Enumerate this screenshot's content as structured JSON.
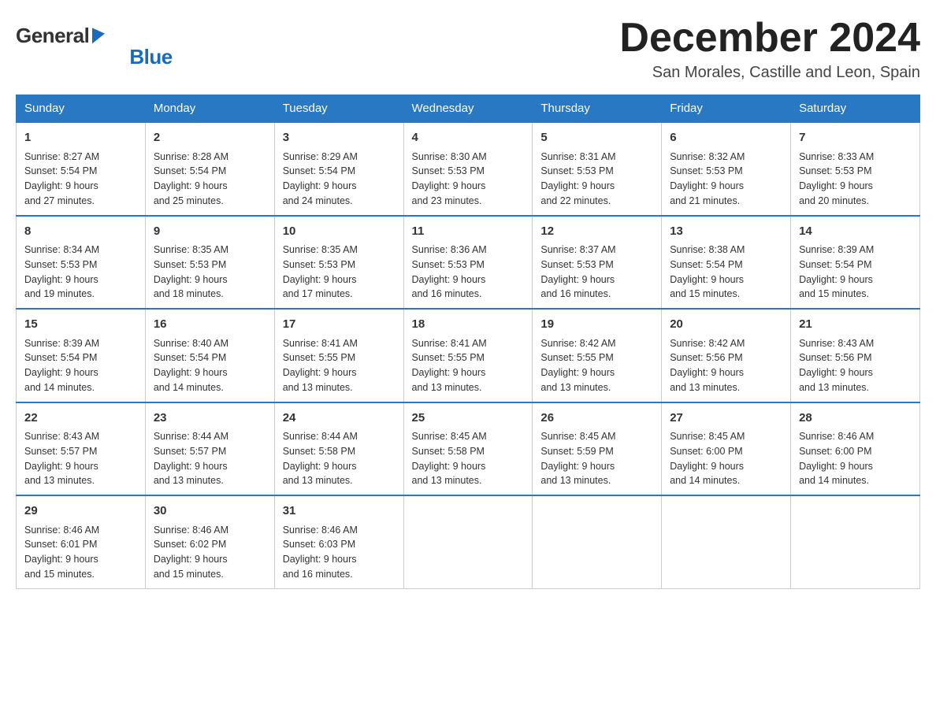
{
  "header": {
    "logo_general": "General",
    "logo_blue": "Blue",
    "month_title": "December 2024",
    "location": "San Morales, Castille and Leon, Spain"
  },
  "weekdays": [
    "Sunday",
    "Monday",
    "Tuesday",
    "Wednesday",
    "Thursday",
    "Friday",
    "Saturday"
  ],
  "weeks": [
    [
      {
        "day": "1",
        "sunrise": "8:27 AM",
        "sunset": "5:54 PM",
        "daylight": "9 hours and 27 minutes."
      },
      {
        "day": "2",
        "sunrise": "8:28 AM",
        "sunset": "5:54 PM",
        "daylight": "9 hours and 25 minutes."
      },
      {
        "day": "3",
        "sunrise": "8:29 AM",
        "sunset": "5:54 PM",
        "daylight": "9 hours and 24 minutes."
      },
      {
        "day": "4",
        "sunrise": "8:30 AM",
        "sunset": "5:53 PM",
        "daylight": "9 hours and 23 minutes."
      },
      {
        "day": "5",
        "sunrise": "8:31 AM",
        "sunset": "5:53 PM",
        "daylight": "9 hours and 22 minutes."
      },
      {
        "day": "6",
        "sunrise": "8:32 AM",
        "sunset": "5:53 PM",
        "daylight": "9 hours and 21 minutes."
      },
      {
        "day": "7",
        "sunrise": "8:33 AM",
        "sunset": "5:53 PM",
        "daylight": "9 hours and 20 minutes."
      }
    ],
    [
      {
        "day": "8",
        "sunrise": "8:34 AM",
        "sunset": "5:53 PM",
        "daylight": "9 hours and 19 minutes."
      },
      {
        "day": "9",
        "sunrise": "8:35 AM",
        "sunset": "5:53 PM",
        "daylight": "9 hours and 18 minutes."
      },
      {
        "day": "10",
        "sunrise": "8:35 AM",
        "sunset": "5:53 PM",
        "daylight": "9 hours and 17 minutes."
      },
      {
        "day": "11",
        "sunrise": "8:36 AM",
        "sunset": "5:53 PM",
        "daylight": "9 hours and 16 minutes."
      },
      {
        "day": "12",
        "sunrise": "8:37 AM",
        "sunset": "5:53 PM",
        "daylight": "9 hours and 16 minutes."
      },
      {
        "day": "13",
        "sunrise": "8:38 AM",
        "sunset": "5:54 PM",
        "daylight": "9 hours and 15 minutes."
      },
      {
        "day": "14",
        "sunrise": "8:39 AM",
        "sunset": "5:54 PM",
        "daylight": "9 hours and 15 minutes."
      }
    ],
    [
      {
        "day": "15",
        "sunrise": "8:39 AM",
        "sunset": "5:54 PM",
        "daylight": "9 hours and 14 minutes."
      },
      {
        "day": "16",
        "sunrise": "8:40 AM",
        "sunset": "5:54 PM",
        "daylight": "9 hours and 14 minutes."
      },
      {
        "day": "17",
        "sunrise": "8:41 AM",
        "sunset": "5:55 PM",
        "daylight": "9 hours and 13 minutes."
      },
      {
        "day": "18",
        "sunrise": "8:41 AM",
        "sunset": "5:55 PM",
        "daylight": "9 hours and 13 minutes."
      },
      {
        "day": "19",
        "sunrise": "8:42 AM",
        "sunset": "5:55 PM",
        "daylight": "9 hours and 13 minutes."
      },
      {
        "day": "20",
        "sunrise": "8:42 AM",
        "sunset": "5:56 PM",
        "daylight": "9 hours and 13 minutes."
      },
      {
        "day": "21",
        "sunrise": "8:43 AM",
        "sunset": "5:56 PM",
        "daylight": "9 hours and 13 minutes."
      }
    ],
    [
      {
        "day": "22",
        "sunrise": "8:43 AM",
        "sunset": "5:57 PM",
        "daylight": "9 hours and 13 minutes."
      },
      {
        "day": "23",
        "sunrise": "8:44 AM",
        "sunset": "5:57 PM",
        "daylight": "9 hours and 13 minutes."
      },
      {
        "day": "24",
        "sunrise": "8:44 AM",
        "sunset": "5:58 PM",
        "daylight": "9 hours and 13 minutes."
      },
      {
        "day": "25",
        "sunrise": "8:45 AM",
        "sunset": "5:58 PM",
        "daylight": "9 hours and 13 minutes."
      },
      {
        "day": "26",
        "sunrise": "8:45 AM",
        "sunset": "5:59 PM",
        "daylight": "9 hours and 13 minutes."
      },
      {
        "day": "27",
        "sunrise": "8:45 AM",
        "sunset": "6:00 PM",
        "daylight": "9 hours and 14 minutes."
      },
      {
        "day": "28",
        "sunrise": "8:46 AM",
        "sunset": "6:00 PM",
        "daylight": "9 hours and 14 minutes."
      }
    ],
    [
      {
        "day": "29",
        "sunrise": "8:46 AM",
        "sunset": "6:01 PM",
        "daylight": "9 hours and 15 minutes."
      },
      {
        "day": "30",
        "sunrise": "8:46 AM",
        "sunset": "6:02 PM",
        "daylight": "9 hours and 15 minutes."
      },
      {
        "day": "31",
        "sunrise": "8:46 AM",
        "sunset": "6:03 PM",
        "daylight": "9 hours and 16 minutes."
      },
      null,
      null,
      null,
      null
    ]
  ],
  "labels": {
    "sunrise": "Sunrise:",
    "sunset": "Sunset:",
    "daylight": "Daylight:"
  }
}
